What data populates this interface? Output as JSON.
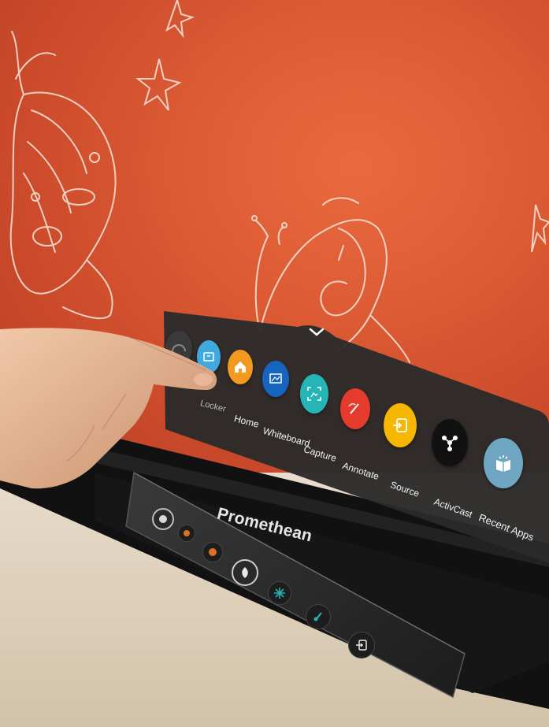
{
  "menu": {
    "toggle_icon": "chevron-down-icon",
    "apps": [
      {
        "label": "",
        "icon": "partial-icon",
        "color": "#3a3a3a"
      },
      {
        "label": "Locker",
        "icon": "locker-icon",
        "color": "#3fa9e0"
      },
      {
        "label": "Home",
        "icon": "home-icon",
        "color": "#f29a1f"
      },
      {
        "label": "Whiteboard",
        "icon": "whiteboard-icon",
        "color": "#1565c0"
      },
      {
        "label": "Capture",
        "icon": "capture-icon",
        "color": "#26b5b5"
      },
      {
        "label": "Annotate",
        "icon": "annotate-icon",
        "color": "#e53b2c"
      },
      {
        "label": "Source",
        "icon": "source-icon",
        "color": "#f5b700"
      },
      {
        "label": "ActivCast",
        "icon": "activcast-icon",
        "color": "#111111"
      },
      {
        "label": "Recent Apps",
        "icon": "recent-apps-icon",
        "color": "#6fa6c2"
      }
    ]
  },
  "device": {
    "brand": "Promethean",
    "buttons": [
      {
        "icon": "power-icon",
        "color": "#d8d8d8"
      },
      {
        "icon": "orange-led-icon",
        "color": "#e07020"
      },
      {
        "icon": "orange-led-icon",
        "color": "#e07020"
      },
      {
        "icon": "promethean-logo-icon",
        "color": "#e8e8e8"
      },
      {
        "icon": "freeze-icon",
        "color": "#2bb0b0"
      },
      {
        "icon": "annotate-icon",
        "color": "#2bb0b0"
      },
      {
        "icon": "source-icon",
        "color": "#e8e8e8"
      }
    ]
  }
}
